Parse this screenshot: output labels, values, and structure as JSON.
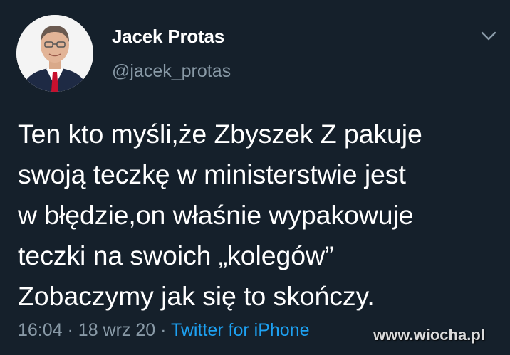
{
  "tweet": {
    "author": {
      "name": "Jacek Protas",
      "handle": "@jacek_protas",
      "avatar_icon": "profile-photo"
    },
    "menu_icon": "chevron-down-icon",
    "text_lines": [
      "Ten kto myśli,że Zbyszek Z pakuje",
      "swoją teczkę w ministerstwie jest",
      "w błędzie,on właśnie wypakowuje",
      "teczki na swoich „kolegów”",
      "Zobaczymy jak się to skończy."
    ],
    "time": "16:04",
    "separator": "·",
    "date": "18 wrz 20",
    "source": "Twitter for iPhone"
  },
  "watermark": "www.wiocha.pl",
  "colors": {
    "background": "#15202b",
    "text": "#ffffff",
    "muted": "#8899a6",
    "link": "#1da1f2"
  }
}
